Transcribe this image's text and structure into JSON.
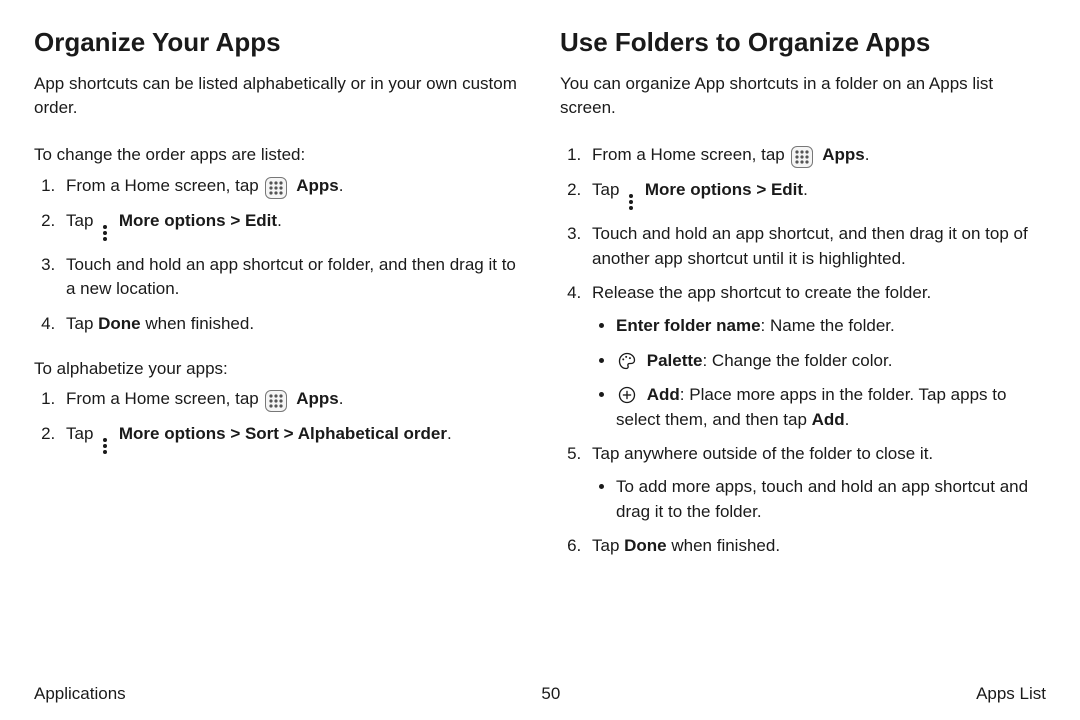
{
  "left": {
    "heading": "Organize Your Apps",
    "intro": "App shortcuts can be listed alphabetically or in your own custom order.",
    "lead1": "To change the order apps are listed:",
    "s1_pre": "From a Home screen, tap ",
    "apps_label": "Apps",
    "s1_post": ".",
    "s2_pre": "Tap ",
    "s2_bold": "More options > Edit",
    "s2_post": ".",
    "s3": "Touch and hold an app shortcut or folder, and then drag it to a new location.",
    "s4_pre": "Tap ",
    "s4_bold": "Done",
    "s4_post": " when finished.",
    "lead2": "To alphabetize your apps:",
    "a1_pre": "From a Home screen, tap ",
    "a2_pre": "Tap ",
    "a2_bold": "More options > Sort > Alphabetical order",
    "a2_post": "."
  },
  "right": {
    "heading": "Use Folders to Organize Apps",
    "intro": "You can organize App shortcuts in a folder on an Apps list screen.",
    "s1_pre": "From a Home screen, tap ",
    "apps_label": "Apps",
    "s1_post": ".",
    "s2_pre": "Tap ",
    "s2_bold": "More options > Edit",
    "s2_post": ".",
    "s3": "Touch and hold an app shortcut, and then drag it on top of another app shortcut until it is highlighted.",
    "s4": "Release the app shortcut to create the folder.",
    "b1_bold": "Enter folder name",
    "b1_rest": ": Name the folder.",
    "b2_bold": "Palette",
    "b2_rest": ": Change the folder color.",
    "b3_bold": "Add",
    "b3_rest_a": ": Place more apps in the folder. Tap apps to select them, and then tap ",
    "b3_add": "Add",
    "b3_rest_b": ".",
    "s5": "Tap anywhere outside of the folder to close it.",
    "b5": "To add more apps, touch and hold an app shortcut and drag it to the folder.",
    "s6_pre": "Tap ",
    "s6_bold": "Done",
    "s6_post": " when finished."
  },
  "footer": {
    "left": "Applications",
    "center": "50",
    "right": "Apps List"
  }
}
